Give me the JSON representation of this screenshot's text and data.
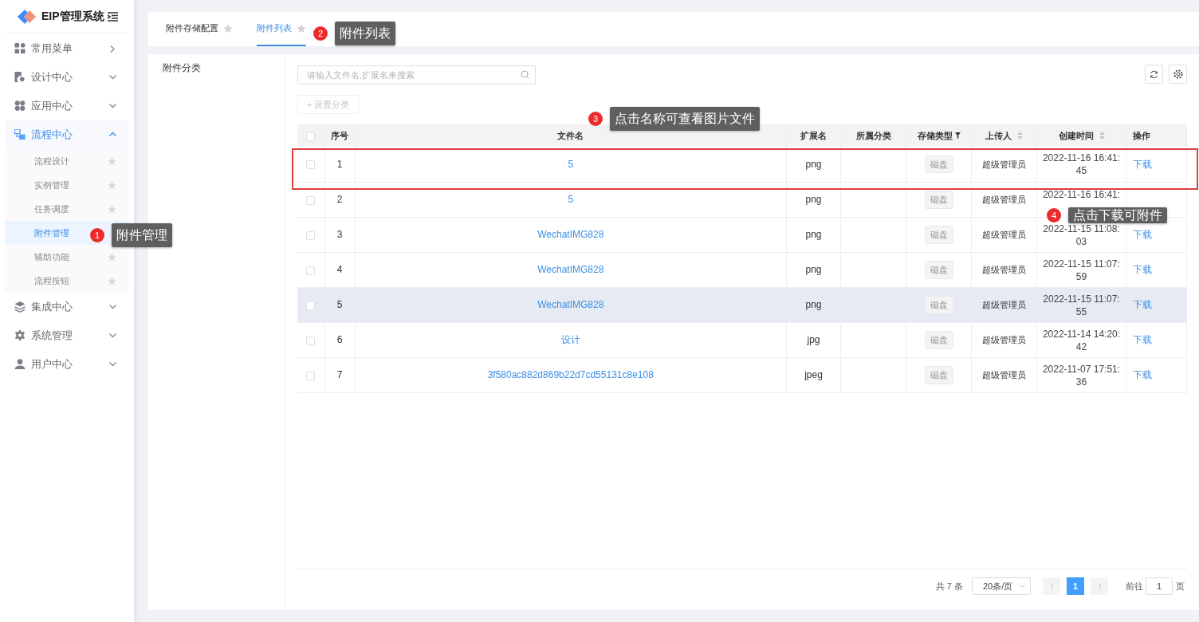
{
  "sidebar": {
    "title": "EIP管理系统",
    "items": [
      {
        "label": "常用菜单",
        "kind": "flyout",
        "selected": false
      },
      {
        "label": "设计中心",
        "kind": "group",
        "expanded": false,
        "selected": false
      },
      {
        "label": "应用中心",
        "kind": "group",
        "expanded": false,
        "selected": false
      },
      {
        "label": "流程中心",
        "kind": "group",
        "expanded": true,
        "selected": true,
        "children": [
          {
            "label": "流程设计",
            "selected": false
          },
          {
            "label": "实例管理",
            "selected": false
          },
          {
            "label": "任务调度",
            "selected": false
          },
          {
            "label": "附件管理",
            "selected": true
          },
          {
            "label": "辅助功能",
            "selected": false
          },
          {
            "label": "流程按钮",
            "selected": false
          }
        ]
      },
      {
        "label": "集成中心",
        "kind": "group",
        "expanded": false,
        "selected": false
      },
      {
        "label": "系统管理",
        "kind": "group",
        "expanded": false,
        "selected": false
      },
      {
        "label": "用户中心",
        "kind": "group",
        "expanded": false,
        "selected": false
      }
    ]
  },
  "tabs": [
    {
      "label": "附件存储配置",
      "selected": false
    },
    {
      "label": "附件列表",
      "selected": true
    }
  ],
  "category_panel": {
    "title": "附件分类"
  },
  "search": {
    "placeholder": "请输入文件名,扩展名来搜索"
  },
  "set_category_button": "+ 设置分类",
  "table": {
    "select_all_checked": false,
    "columns": [
      {
        "label": "序号"
      },
      {
        "label": "文件名"
      },
      {
        "label": "扩展名"
      },
      {
        "label": "所属分类"
      },
      {
        "label": "存储类型",
        "filter": true
      },
      {
        "label": "上传人",
        "sort": true
      },
      {
        "label": "创建时间",
        "sort": true
      },
      {
        "label": "操作"
      }
    ],
    "rows": [
      {
        "index": "1",
        "name": "5",
        "ext": "png",
        "storage": "磁盘",
        "uploader": "超级管理员",
        "created": "2022-11-16 16:41:45",
        "action": "下载",
        "hovered": false,
        "checked": false
      },
      {
        "index": "2",
        "name": "5",
        "ext": "png",
        "storage": "磁盘",
        "uploader": "超级管理员",
        "created": "2022-11-16 16:41:",
        "hovered": false,
        "checked": false
      },
      {
        "index": "3",
        "name": "WechatIMG828",
        "ext": "png",
        "storage": "磁盘",
        "uploader": "超级管理员",
        "created": "2022-11-15 11:08:03",
        "action": "下载",
        "hovered": false,
        "checked": false
      },
      {
        "index": "4",
        "name": "WechatIMG828",
        "ext": "png",
        "storage": "磁盘",
        "uploader": "超级管理员",
        "created": "2022-11-15 11:07:59",
        "action": "下载",
        "hovered": false,
        "checked": false
      },
      {
        "index": "5",
        "name": "WechatIMG828",
        "ext": "png",
        "storage": "磁盘",
        "uploader": "超级管理员",
        "created": "2022-11-15 11:07:55",
        "action": "下载",
        "hovered": true,
        "checked": false
      },
      {
        "index": "6",
        "name": "设计",
        "ext": "jpg",
        "storage": "磁盘",
        "uploader": "超级管理员",
        "created": "2022-11-14 14:20:42",
        "action": "下载",
        "hovered": false,
        "checked": false
      },
      {
        "index": "7",
        "name": "3f580ac882d869b22d7cd55131c8e108",
        "ext": "jpeg",
        "storage": "磁盘",
        "uploader": "超级管理员",
        "created": "2022-11-07 17:51:36",
        "action": "下载",
        "hovered": false,
        "checked": false
      }
    ]
  },
  "pagination": {
    "total": "共 7 条",
    "page_size": "20条/页",
    "pages": [
      {
        "label": "1",
        "selected": true
      }
    ],
    "goto_label": "前往",
    "goto_value": "1",
    "goto_suffix": "页"
  },
  "callouts": [
    {
      "number": "1",
      "text": "附件管理"
    },
    {
      "number": "2",
      "text": "附件列表"
    },
    {
      "number": "3",
      "text": "点击名称可查看图片文件"
    },
    {
      "number": "4",
      "text": "点击下载可附件"
    }
  ]
}
